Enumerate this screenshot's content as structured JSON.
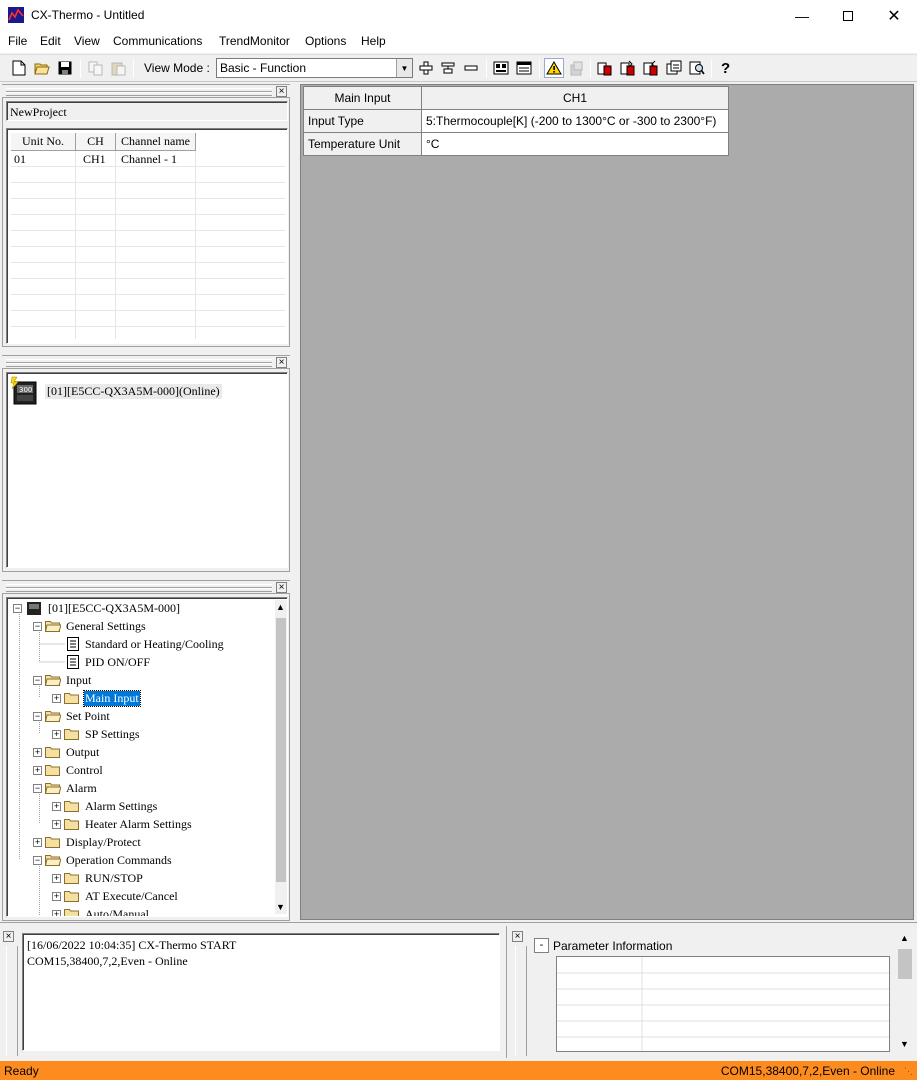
{
  "window": {
    "title": "CX-Thermo - Untitled",
    "minimize_icon": "minimize-icon",
    "maximize_icon": "maximize-icon",
    "close_icon": "close-icon"
  },
  "menu": {
    "items": [
      "File",
      "Edit",
      "View",
      "Communications",
      "TrendMonitor",
      "Options",
      "Help"
    ]
  },
  "toolbar": {
    "view_mode_label": "View Mode :",
    "view_mode_value": "Basic - Function",
    "icons": [
      "new-file-icon",
      "open-folder-icon",
      "save-icon",
      "copy-icon",
      "paste-icon",
      "expand-icon",
      "compare-icon",
      "collapse-icon",
      "device-view-icon",
      "monitor-icon",
      "warning-icon",
      "disabled-icon",
      "transfer-icon",
      "transfer-to-device-icon",
      "transfer-from-device-icon",
      "verify-icon",
      "search-icon",
      "help-icon"
    ]
  },
  "project": {
    "name": "NewProject"
  },
  "unit_table": {
    "headers": [
      "Unit No.",
      "CH",
      "Channel name"
    ],
    "rows": [
      [
        "01",
        "CH1",
        "Channel - 1"
      ]
    ]
  },
  "device": {
    "label": "[01][E5CC-QX3A5M-000](Online)"
  },
  "tree": {
    "root": "[01][E5CC-QX3A5M-000]",
    "nodes": [
      "General Settings",
      "Standard or Heating/Cooling",
      "PID ON/OFF",
      "Input",
      "Main Input",
      "Set Point",
      "SP Settings",
      "Output",
      "Control",
      "Alarm",
      "Alarm Settings",
      "Heater Alarm Settings",
      "Display/Protect",
      "Operation Commands",
      "RUN/STOP",
      "AT Execute/Cancel",
      "Auto/Manual"
    ]
  },
  "parameter_grid": {
    "header_label": "Main Input",
    "header_ch": "CH1",
    "rows": [
      {
        "label": "Input Type",
        "value": "5:Thermocouple[K] (-200 to 1300°C or -300 to 2300°F)"
      },
      {
        "label": "Temperature Unit",
        "value": "°C"
      }
    ]
  },
  "log": {
    "lines": [
      "[16/06/2022 10:04:35] CX-Thermo START",
      "COM15,38400,7,2,Even - Online"
    ]
  },
  "param_info": {
    "toggle": "-",
    "title": "Parameter Information"
  },
  "status": {
    "left": "Ready",
    "right": "COM15,38400,7,2,Even - Online",
    "bar_color": "#fe8b1e"
  }
}
